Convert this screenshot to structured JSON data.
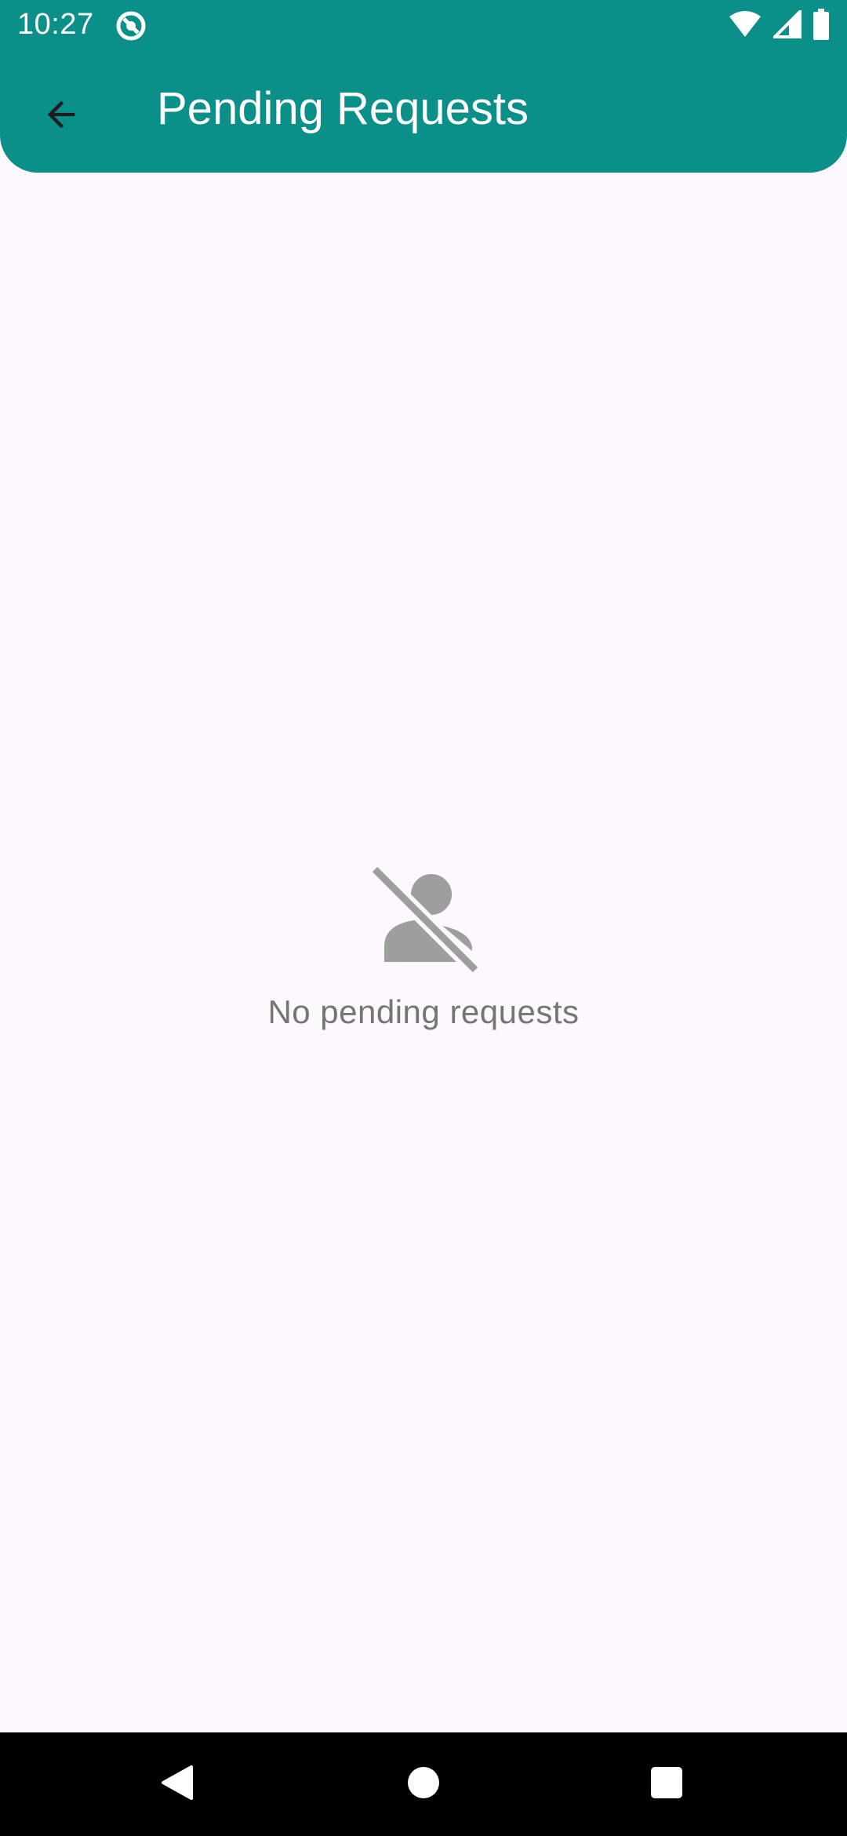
{
  "status_bar": {
    "time": "10:27",
    "icons": [
      "app-notification-icon",
      "wifi-icon",
      "cellular-icon",
      "battery-icon"
    ]
  },
  "app_bar": {
    "title": "Pending Requests",
    "back_icon": "arrow-back-icon",
    "background_color": "#0b8f89"
  },
  "empty_state": {
    "icon": "person-off-icon",
    "message": "No pending requests"
  },
  "nav_bar": {
    "buttons": [
      "back-triangle-icon",
      "home-circle-icon",
      "recents-square-icon"
    ]
  },
  "colors": {
    "accent": "#0b8f89",
    "background": "#fdf7fe",
    "muted_text": "#757575",
    "icon_gray": "#9e9e9e"
  }
}
